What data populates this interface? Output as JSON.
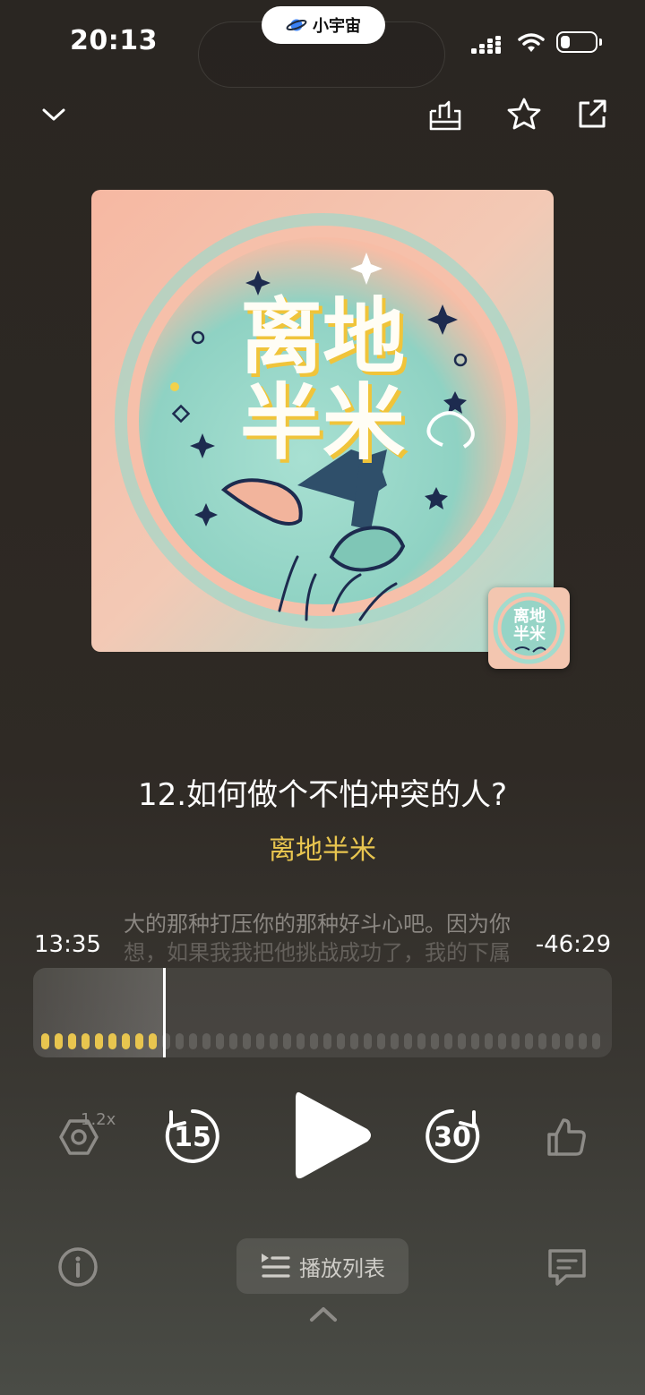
{
  "status_bar": {
    "time": "20:13",
    "island_app": "小宇宙",
    "battery_level": 0.25
  },
  "header": {
    "collapse_icon": "chevron-down-icon",
    "actions": [
      "tray-download-icon",
      "star-icon",
      "share-icon"
    ]
  },
  "cover": {
    "title_line1": "离地",
    "title_line2": "半米"
  },
  "episode": {
    "title": "12.如何做个不怕冲突的人?",
    "podcast_name": "离地半米",
    "transcript_line1": "大的那种打压你的那种好斗心吧。因为你",
    "transcript_line2": "想，如果我我把他挑战成功了，我的下属"
  },
  "progress": {
    "elapsed": "13:35",
    "remaining": "-46:29",
    "played_fraction": 0.226
  },
  "controls": {
    "speed": "1.2x",
    "rewind_seconds": "15",
    "forward_seconds": "30",
    "playlist_label": "播放列表"
  },
  "colors": {
    "accent": "#e8c54f",
    "background_top": "#2a2622",
    "background_bottom": "#4a4c46"
  }
}
